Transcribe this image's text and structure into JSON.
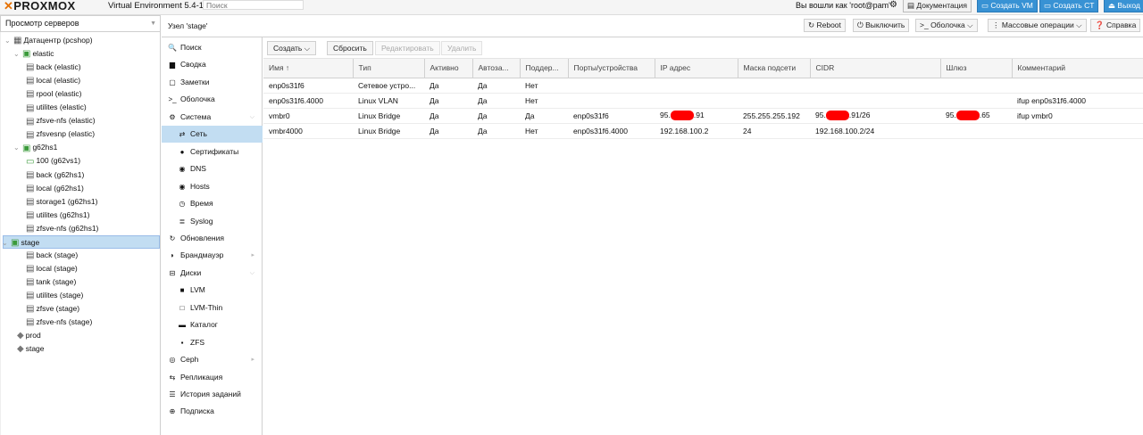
{
  "app": {
    "logo": "PROXMOX",
    "version": "Virtual Environment 5.4-13",
    "search_placeholder": "Поиск",
    "logged_in": "Вы вошли как 'root@pam'",
    "buttons": {
      "docs": "Документация",
      "create_vm": "Создать VM",
      "create_ct": "Создать CT",
      "logout": "Выход"
    }
  },
  "tree": {
    "view_label": "Просмотр серверов",
    "nodes": [
      {
        "label": "Датацентр (pcshop)",
        "icon": "datacenter-icon"
      },
      {
        "label": "elastic",
        "icon": "node-online-icon"
      },
      {
        "label": "back (elastic)",
        "icon": "storage-icon"
      },
      {
        "label": "local (elastic)",
        "icon": "storage-icon"
      },
      {
        "label": "rpool (elastic)",
        "icon": "storage-icon"
      },
      {
        "label": "utilites (elastic)",
        "icon": "storage-icon"
      },
      {
        "label": "zfsve-nfs (elastic)",
        "icon": "storage-icon"
      },
      {
        "label": "zfsvesnp (elastic)",
        "icon": "storage-icon"
      },
      {
        "label": "g62hs1",
        "icon": "node-online-icon"
      },
      {
        "label": "100 (g62vs1)",
        "icon": "vm-running-icon"
      },
      {
        "label": "back (g62hs1)",
        "icon": "storage-icon"
      },
      {
        "label": "local (g62hs1)",
        "icon": "storage-icon"
      },
      {
        "label": "storage1 (g62hs1)",
        "icon": "storage-icon"
      },
      {
        "label": "utilites (g62hs1)",
        "icon": "storage-icon"
      },
      {
        "label": "zfsve-nfs (g62hs1)",
        "icon": "storage-icon"
      },
      {
        "label": "stage",
        "icon": "node-online-icon"
      },
      {
        "label": "back (stage)",
        "icon": "storage-icon"
      },
      {
        "label": "local (stage)",
        "icon": "storage-icon"
      },
      {
        "label": "tank (stage)",
        "icon": "storage-icon"
      },
      {
        "label": "utilites (stage)",
        "icon": "storage-icon"
      },
      {
        "label": "zfsve (stage)",
        "icon": "storage-icon"
      },
      {
        "label": "zfsve-nfs (stage)",
        "icon": "storage-icon"
      },
      {
        "label": "prod",
        "icon": "tag-icon"
      },
      {
        "label": "stage",
        "icon": "tag-icon"
      }
    ]
  },
  "header": {
    "title": "Узел 'stage'",
    "actions": {
      "reboot": "Reboot",
      "shutdown": "Выключить",
      "shell": "Оболочка",
      "bulk": "Массовые операции",
      "help": "Справка"
    }
  },
  "menu": [
    {
      "label": "Поиск",
      "icon": "search-icon"
    },
    {
      "label": "Сводка",
      "icon": "summary-icon"
    },
    {
      "label": "Заметки",
      "icon": "notes-icon"
    },
    {
      "label": "Оболочка",
      "icon": "terminal-icon"
    },
    {
      "label": "Система",
      "icon": "cogs-icon"
    },
    {
      "label": "Сеть",
      "icon": "network-icon"
    },
    {
      "label": "Сертификаты",
      "icon": "certificate-icon"
    },
    {
      "label": "DNS",
      "icon": "globe-icon"
    },
    {
      "label": "Hosts",
      "icon": "globe-icon"
    },
    {
      "label": "Время",
      "icon": "clock-icon"
    },
    {
      "label": "Syslog",
      "icon": "list-icon"
    },
    {
      "label": "Обновления",
      "icon": "refresh-icon"
    },
    {
      "label": "Брандмауэр",
      "icon": "shield-icon"
    },
    {
      "label": "Диски",
      "icon": "hdd-icon"
    },
    {
      "label": "LVM",
      "icon": "square-icon"
    },
    {
      "label": "LVM-Thin",
      "icon": "square-outline-icon"
    },
    {
      "label": "Каталог",
      "icon": "folder-icon"
    },
    {
      "label": "ZFS",
      "icon": "th-large-icon"
    },
    {
      "label": "Ceph",
      "icon": "ceph-icon"
    },
    {
      "label": "Репликация",
      "icon": "retweet-icon"
    },
    {
      "label": "История заданий",
      "icon": "list-alt-icon"
    },
    {
      "label": "Подписка",
      "icon": "support-icon"
    }
  ],
  "toolbar": {
    "create": "Создать",
    "revert": "Сбросить",
    "edit": "Редактировать",
    "remove": "Удалить"
  },
  "grid": {
    "columns": [
      "Имя ↑",
      "Тип",
      "Активно",
      "Автоза...",
      "Поддер...",
      "Порты/устройства",
      "IP адрес",
      "Маска подсети",
      "CIDR",
      "Шлюз",
      "Комментарий"
    ],
    "rows": [
      [
        "enp0s31f6",
        "Сетевое устро...",
        "Да",
        "Да",
        "Нет",
        "",
        "",
        "",
        "",
        "",
        ""
      ],
      [
        "enp0s31f6.4000",
        "Linux VLAN",
        "Да",
        "Да",
        "Нет",
        "",
        "",
        "",
        "",
        "",
        "ifup enp0s31f6.4000"
      ],
      [
        "vmbr0",
        "Linux Bridge",
        "Да",
        "Да",
        "Да",
        "enp0s31f6",
        "95.",
        "255.255.255.192",
        "95.",
        "95.",
        "ifup vmbr0"
      ],
      [
        "vmbr4000",
        "Linux Bridge",
        "Да",
        "Да",
        "Нет",
        "enp0s31f6.4000",
        "192.168.100.2",
        "24",
        "192.168.100.2/24",
        "",
        ""
      ]
    ],
    "redacted_suffix": {
      "ip": ".91",
      "cidr": ".91/26",
      "gateway": ".65"
    }
  }
}
